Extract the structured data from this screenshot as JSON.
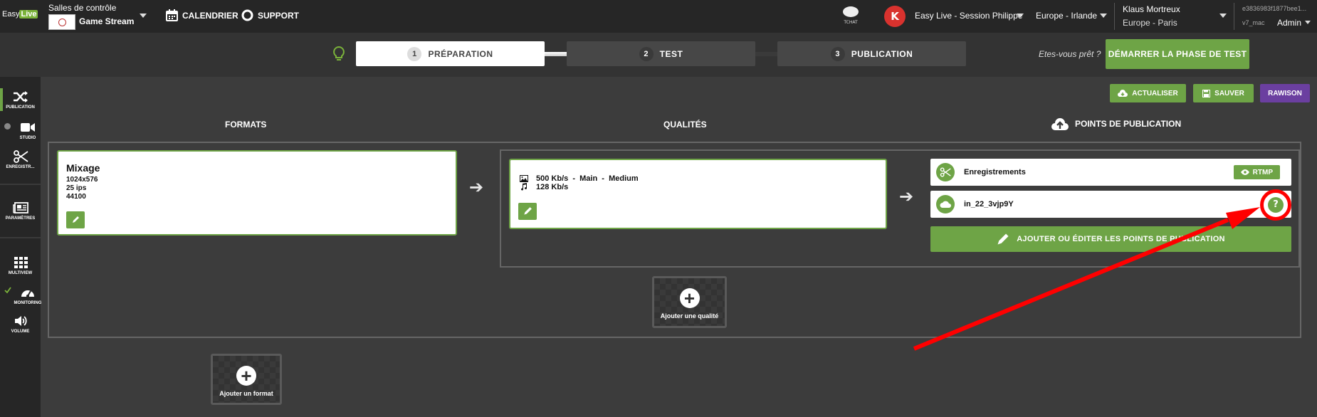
{
  "topbar": {
    "logo_prefix": "Easy",
    "logo_suffix": "Live",
    "salles_label": "Salles de contrôle",
    "stream_name": "Game Stream",
    "nav": [
      {
        "label": "CALENDRIER",
        "icon": "calendar-icon"
      },
      {
        "label": "SUPPORT",
        "icon": "lifebuoy-icon"
      }
    ],
    "tchat_label": "TCHAT",
    "avatar_letter": "K",
    "session": "Easy Live - Session Philippe",
    "region": "Europe - Irlande",
    "user_name": "Klaus Mortreux",
    "timezone": "Europe - Paris",
    "session_id": "e3836983f1877bee1...",
    "machine": "v7_mac",
    "role": "Admin"
  },
  "steps": [
    {
      "num": "1",
      "label": "PRÉPARATION",
      "active": true
    },
    {
      "num": "2",
      "label": "TEST",
      "active": false
    },
    {
      "num": "3",
      "label": "PUBLICATION",
      "active": false
    }
  ],
  "ready_text": "Etes-vous prêt ?",
  "start_button": "DÉMARRER LA PHASE DE TEST",
  "actions": {
    "refresh": "ACTUALISER",
    "save": "SAUVER",
    "user": "RAWISON"
  },
  "sidebar": [
    {
      "label": "PUBLICATION",
      "icon": "shuffle-icon"
    },
    {
      "label": "STUDIO",
      "icon": "video-camera-icon"
    },
    {
      "label": "ENREGISTR...",
      "icon": "scissors-icon"
    },
    {
      "label": "PARAMÈTRES",
      "icon": "newspaper-icon"
    },
    {
      "label": "MULTIVIEW",
      "icon": "grid-icon"
    },
    {
      "label": "MONITORING",
      "icon": "dashboard-icon"
    },
    {
      "label": "VOLUME",
      "icon": "volume-icon"
    }
  ],
  "columns": {
    "formats": "FORMATS",
    "qualities": "QUALITÉS",
    "points": "POINTS DE PUBLICATION"
  },
  "format_card": {
    "title": "Mixage",
    "resolution": "1024x576",
    "fps": "25 ips",
    "audio": "44100"
  },
  "quality_card": {
    "video": "500 Kb/s  -  Main  -  Medium",
    "audio": "128 Kb/s"
  },
  "publication_points": [
    {
      "label": "Enregistrements",
      "icon": "scissors-icon",
      "badge": "RTMP"
    },
    {
      "label": "in_22_3vjp9Y",
      "icon": "cloud-icon"
    }
  ],
  "help_symbol": "?",
  "add_pub_button": "AJOUTER OU ÉDITER LES POINTS DE PUBLICATION",
  "add_quality": "Ajouter une qualité",
  "add_format": "Ajouter un format",
  "plus_symbol": "+",
  "annotation_color": "#ff0000",
  "accent_color": "#6ea446"
}
